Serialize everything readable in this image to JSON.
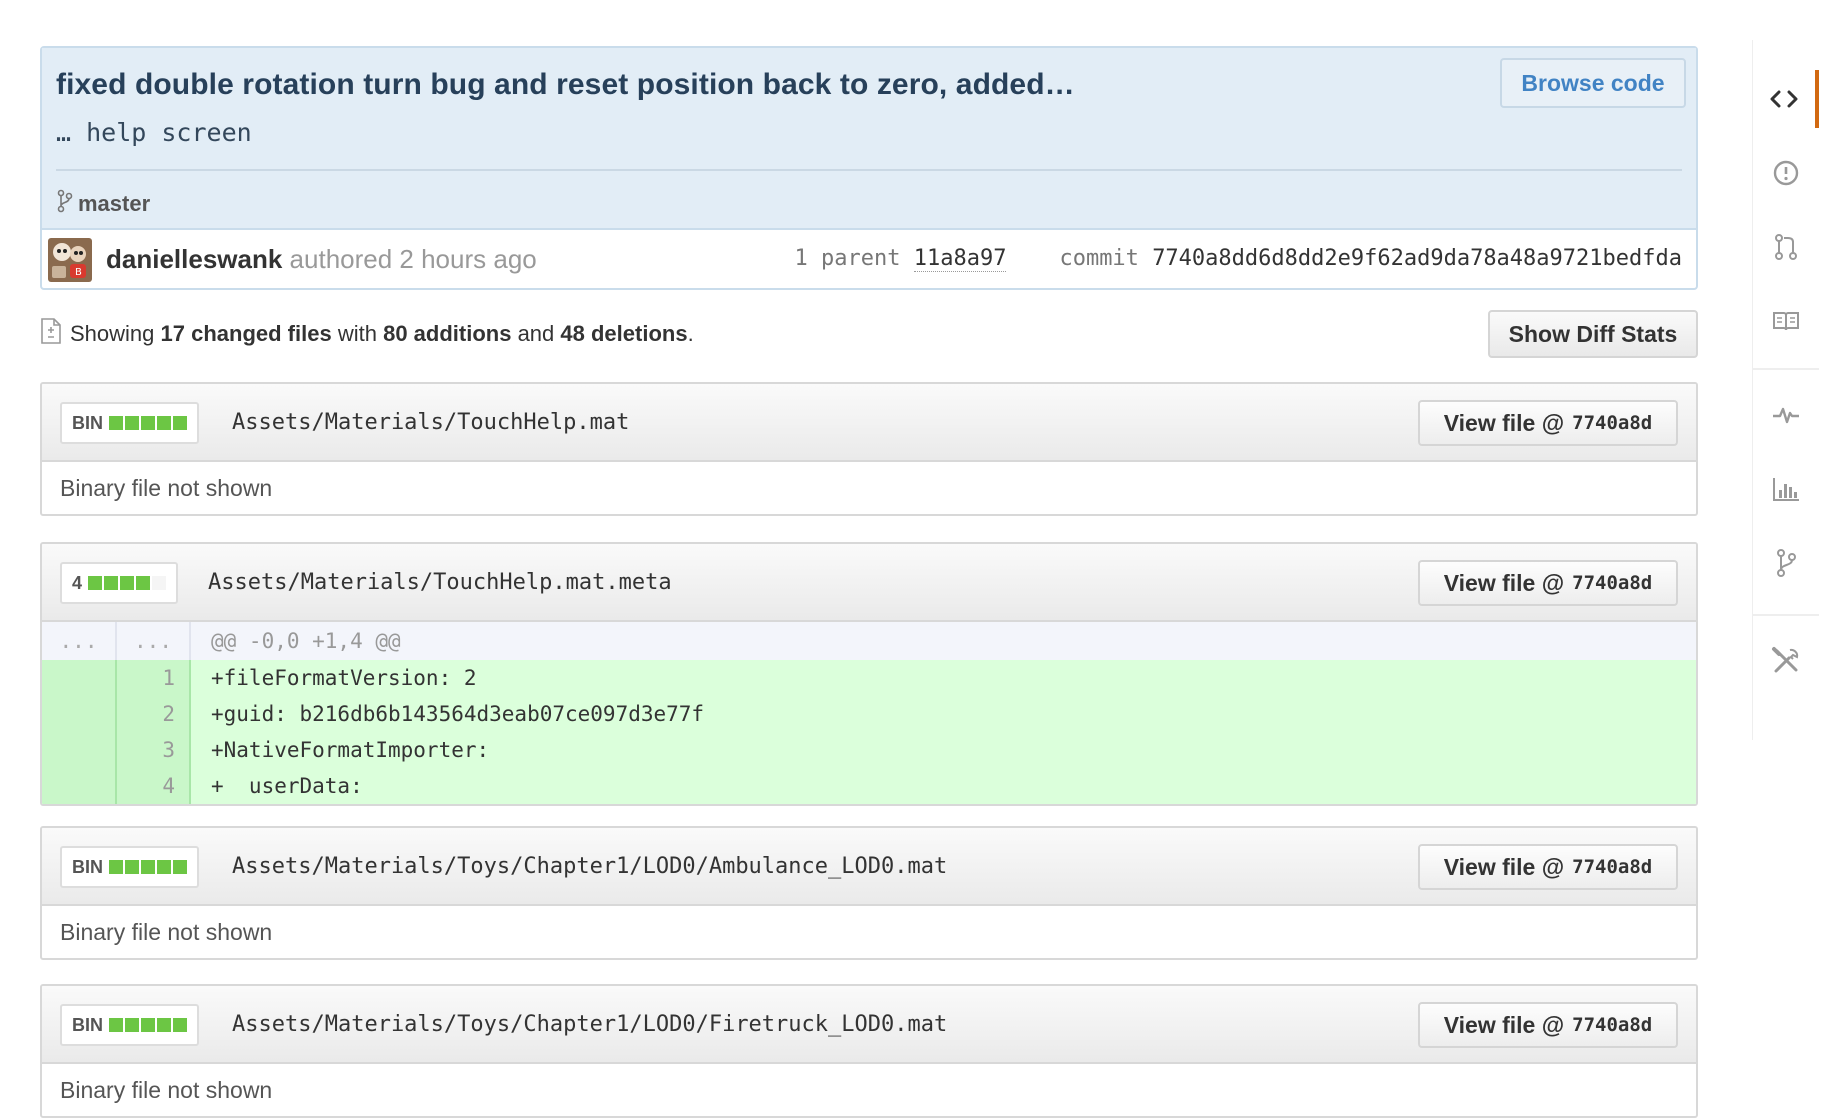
{
  "commit": {
    "title": "fixed double rotation turn bug and reset position back to zero, added…",
    "description": "… help screen",
    "branch": "master",
    "browse_label": "Browse code",
    "author": "danielleswank",
    "authored_text": "authored 2 hours ago",
    "parent_label": "1 parent",
    "parent_sha": "11a8a97",
    "commit_label": "commit",
    "commit_sha": "7740a8dd6d8dd2e9f62ad9da78a48a9721bedfda"
  },
  "summary": {
    "prefix": "Showing",
    "changed": "17 changed files",
    "with": "with",
    "additions": "80 additions",
    "and": "and",
    "deletions": "48 deletions",
    "suffix": ".",
    "diff_stats_label": "Show Diff Stats"
  },
  "view_file_label": "View file @",
  "view_file_sha": "7740a8d",
  "files": [
    {
      "stat": "BIN",
      "path": "Assets/Materials/TouchHelp.mat",
      "body": "Binary file not shown"
    },
    {
      "stat": "4",
      "path": "Assets/Materials/TouchHelp.mat.meta",
      "hunk": "@@ -0,0 +1,4 @@",
      "hunk_left": "...",
      "hunk_right": "...",
      "lines": [
        {
          "n": "1",
          "code": "+fileFormatVersion: 2"
        },
        {
          "n": "2",
          "code": "+guid: b216db6b143564d3eab07ce097d3e77f"
        },
        {
          "n": "3",
          "code": "+NativeFormatImporter:"
        },
        {
          "n": "4",
          "code": "+  userData:"
        }
      ]
    },
    {
      "stat": "BIN",
      "path": "Assets/Materials/Toys/Chapter1/LOD0/Ambulance_LOD0.mat",
      "body": "Binary file not shown"
    },
    {
      "stat": "BIN",
      "path": "Assets/Materials/Toys/Chapter1/LOD0/Firetruck_LOD0.mat",
      "body": "Binary file not shown"
    }
  ],
  "sidebar": [
    "code-icon",
    "issues-icon",
    "pull-request-icon",
    "wiki-icon",
    "pulse-icon",
    "graphs-icon",
    "network-icon",
    "settings-icon"
  ],
  "colors": {
    "accent": "#d26911",
    "link": "#4183c4",
    "added_bg": "#dbffdb",
    "commit_bg": "#e2edf6"
  }
}
